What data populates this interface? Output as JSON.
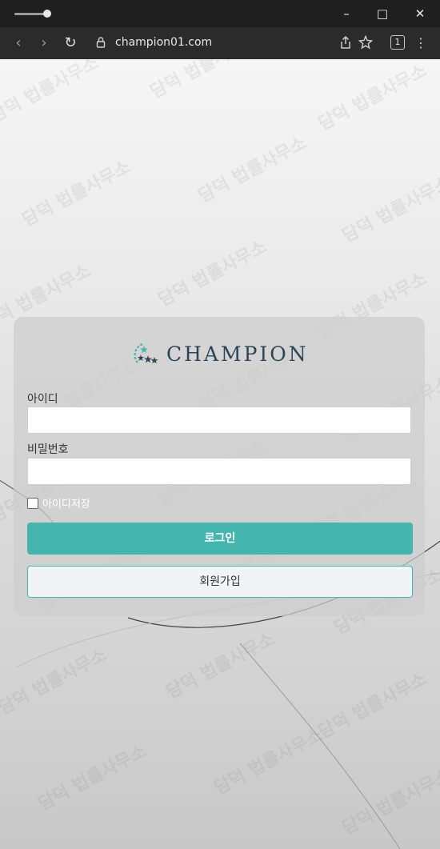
{
  "browser": {
    "url": "champion01.com",
    "tab_count": "1",
    "icons": [
      "back-icon",
      "forward-icon",
      "reload-icon",
      "lock-icon",
      "share-icon",
      "bookmark-icon",
      "tabs-icon",
      "menu-icon",
      "minimize-icon",
      "maximize-icon",
      "close-icon"
    ]
  },
  "login": {
    "logo_text": "CHAMPION",
    "id_label": "아이디",
    "password_label": "비밀번호",
    "remember_label": "아이디저장",
    "login_button": "로그인",
    "signup_button": "회원가입"
  },
  "watermark": "담덕 법률사무소",
  "colors": {
    "accent": "#45b5b0",
    "chrome_dark": "#1f1f1f",
    "toolbar": "#2b2b2b"
  }
}
